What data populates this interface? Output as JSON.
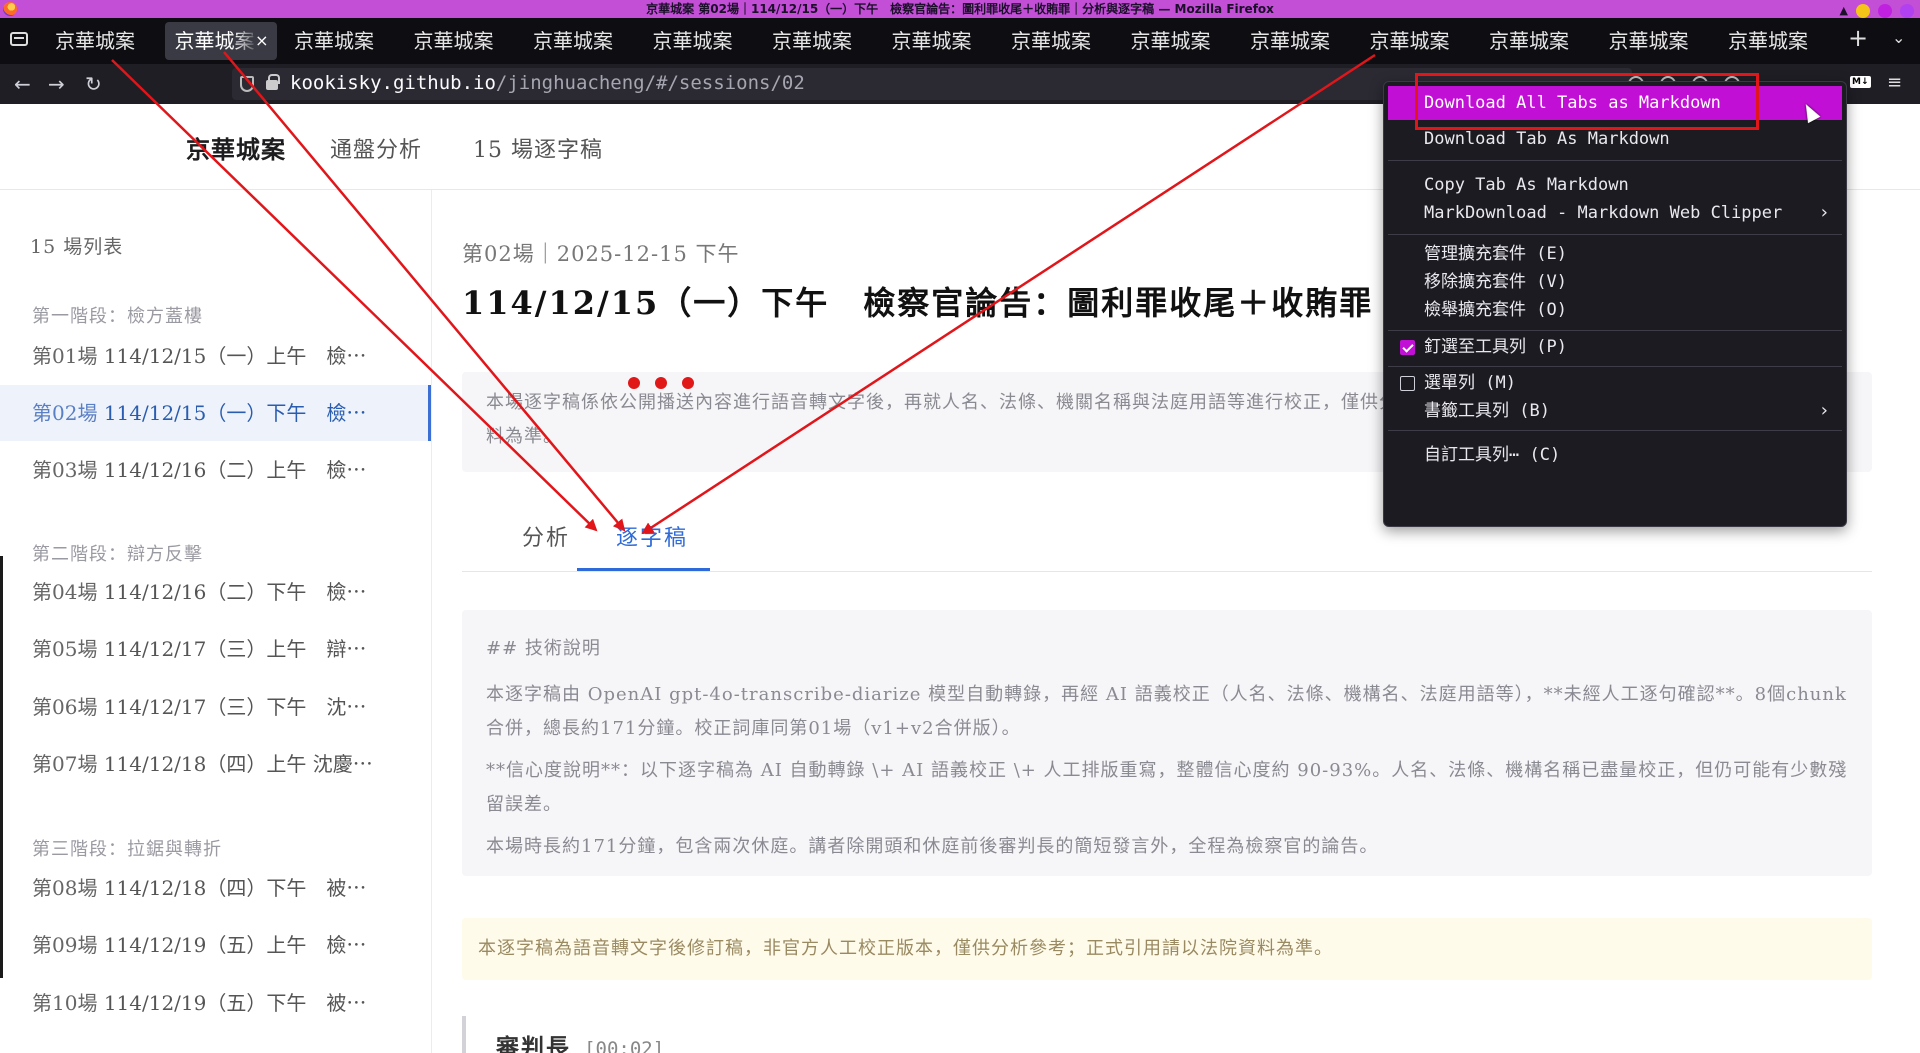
{
  "window": {
    "title": "京華城案 第02場｜114/12/15（一）下午　檢察官論告：圖利罪收尾＋收賄罪｜分析與逐字稿 — Mozilla Firefox"
  },
  "tabs": [
    {
      "label": "京華城案",
      "active": false
    },
    {
      "label": "京華城案",
      "active": true
    },
    {
      "label": "京華城案",
      "active": false
    },
    {
      "label": "京華城案",
      "active": false
    },
    {
      "label": "京華城案",
      "active": false
    },
    {
      "label": "京華城案",
      "active": false
    },
    {
      "label": "京華城案",
      "active": false
    },
    {
      "label": "京華城案",
      "active": false
    },
    {
      "label": "京華城案",
      "active": false
    },
    {
      "label": "京華城案",
      "active": false
    },
    {
      "label": "京華城案",
      "active": false
    },
    {
      "label": "京華城案",
      "active": false
    },
    {
      "label": "京華城案",
      "active": false
    },
    {
      "label": "京華城案",
      "active": false
    },
    {
      "label": "京華城案",
      "active": false
    }
  ],
  "tab_controls": {
    "close": "×",
    "new_tab": "+",
    "list_all": "⌄"
  },
  "url": {
    "host": "kookisky.github.io",
    "path": "/jinghuacheng/#/sessions/02"
  },
  "toolbar": {
    "md_badge": "M↓",
    "menu": "≡"
  },
  "site": {
    "logo": "京華城案",
    "nav": [
      "通盤分析",
      "15 場逐字稿"
    ]
  },
  "sidebar": {
    "title": "15 場列表",
    "groups": [
      {
        "label": "第一階段：檢方蓋樓",
        "items": [
          {
            "num": "第01場",
            "text": "114/12/15（一）上午　檢⋯"
          },
          {
            "num": "第02場",
            "text": "114/12/15（一）下午　檢⋯",
            "active": true
          },
          {
            "num": "第03場",
            "text": "114/12/16（二）上午　檢⋯"
          }
        ]
      },
      {
        "label": "第二階段：辯方反擊",
        "items": [
          {
            "num": "第04場",
            "text": "114/12/16（二）下午　檢⋯"
          },
          {
            "num": "第05場",
            "text": "114/12/17（三）上午　辯⋯"
          },
          {
            "num": "第06場",
            "text": "114/12/17（三）下午　沈⋯"
          },
          {
            "num": "第07場",
            "text": "114/12/18（四）上午 沈慶⋯"
          }
        ]
      },
      {
        "label": "第三階段：拉鋸與轉折",
        "items": [
          {
            "num": "第08場",
            "text": "114/12/18（四）下午　被⋯"
          },
          {
            "num": "第09場",
            "text": "114/12/19（五）上午　檢⋯"
          },
          {
            "num": "第10場",
            "text": "114/12/19（五）下午　被⋯"
          }
        ]
      }
    ]
  },
  "main": {
    "meta": "第02場｜2025-12-15 下午",
    "title": "114/12/15（一）下午　檢察官論告：圖利罪收尾＋收賄罪",
    "notice": "本場逐字稿係依公開播送內容進行語音轉文字後，再就人名、法條、機關名稱與法庭用語等進行校正，僅供分析參考；若需正式引用或確認原意，請以法院正式資料為準。",
    "tabs": [
      "分析",
      "逐字稿"
    ],
    "active_tab": "逐字稿",
    "tech": {
      "heading": "## 技術說明",
      "p1": "本逐字稿由 OpenAI gpt-4o-transcribe-diarize 模型自動轉錄，再經 AI 語義校正（人名、法條、機構名、法庭用語等），**未經人工逐句確認**。8個chunk合併，總長約171分鐘。校正詞庫同第01場（v1+v2合併版）。",
      "p2": "**信心度說明**：以下逐字稿為 AI 自動轉錄 \\+ AI 語義校正 \\+ 人工排版重寫，整體信心度約 90-93%。人名、法條、機構名稱已盡量校正，但仍可能有少數殘留誤差。",
      "p3": "本場時長約171分鐘，包含兩次休庭。講者除開頭和休庭前後審判長的簡短發言外，全程為檢察官的論告。"
    },
    "warning": "本逐字稿為語音轉文字後修訂稿，非官方人工校正版本，僅供分析參考；正式引用請以法院資料為準。",
    "speaker": {
      "name": "審判長",
      "time": "[00:02]"
    }
  },
  "context_menu": {
    "items": [
      {
        "label": "Download All Tabs as Markdown",
        "highlight": true
      },
      {
        "label": "Download Tab As Markdown"
      },
      {
        "label": "Copy Tab As Markdown"
      },
      {
        "label": "MarkDownload - Markdown Web Clipper",
        "submenu": "›"
      },
      {
        "label": "管理擴充套件 (E)"
      },
      {
        "label": "移除擴充套件 (V)"
      },
      {
        "label": "檢舉擴充套件 (O)"
      },
      {
        "label": "釘選至工具列 (P)",
        "checked": true
      },
      {
        "label": "選單列 (M)",
        "checked": false
      },
      {
        "label": "書籤工具列 (B)",
        "submenu": "›"
      },
      {
        "label": "自訂工具列⋯ (C)"
      }
    ]
  },
  "colors": {
    "titlebar": "#c24fd6",
    "menu_highlight": "#c20fd6",
    "annotation_red": "#e0161b",
    "link_blue": "#2f6bd8"
  }
}
